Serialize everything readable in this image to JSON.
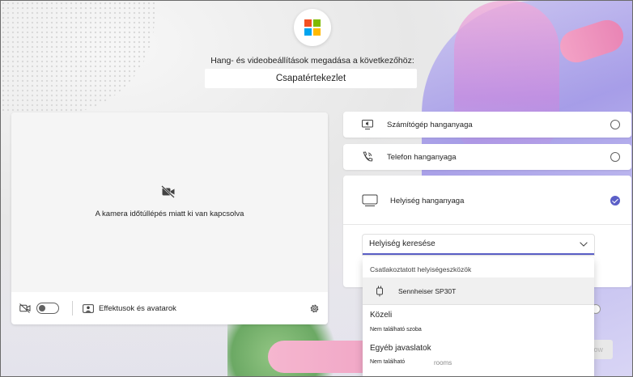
{
  "header": {
    "prompt": "Hang- és videobeállítások megadása a következőhöz:",
    "meeting_title": "Csapatértekezlet",
    "logo_colors": [
      "#f25022",
      "#7fba00",
      "#00a4ef",
      "#ffb900"
    ]
  },
  "video": {
    "camera_off_message": "A kamera időtúllépés miatt ki van kapcsolva",
    "camera_toggle_on": false,
    "effects_label": "Effektusok és avatarok"
  },
  "audio_options": [
    {
      "label": "Számítógép hanganyaga",
      "icon": "computer-audio-icon",
      "selected": false
    },
    {
      "label": "Telefon hanganyaga",
      "icon": "phone-audio-icon",
      "selected": false
    },
    {
      "label": "Helyiség hanganyaga",
      "icon": "room-audio-icon",
      "selected": true
    }
  ],
  "room_search": {
    "value": "Helyiség keresése",
    "connected_header": "Csatlakoztatott helyiségeszközök",
    "connected_devices": [
      "Sennheiser SP30T"
    ],
    "nearby_title": "Közeli",
    "nearby_empty": "Nem található szoba",
    "other_title": "Egyéb javaslatok",
    "other_empty": "Nem található",
    "other_suffix": "rooms"
  },
  "join_button_label": "ow",
  "colors": {
    "accent": "#5b5fc7"
  }
}
